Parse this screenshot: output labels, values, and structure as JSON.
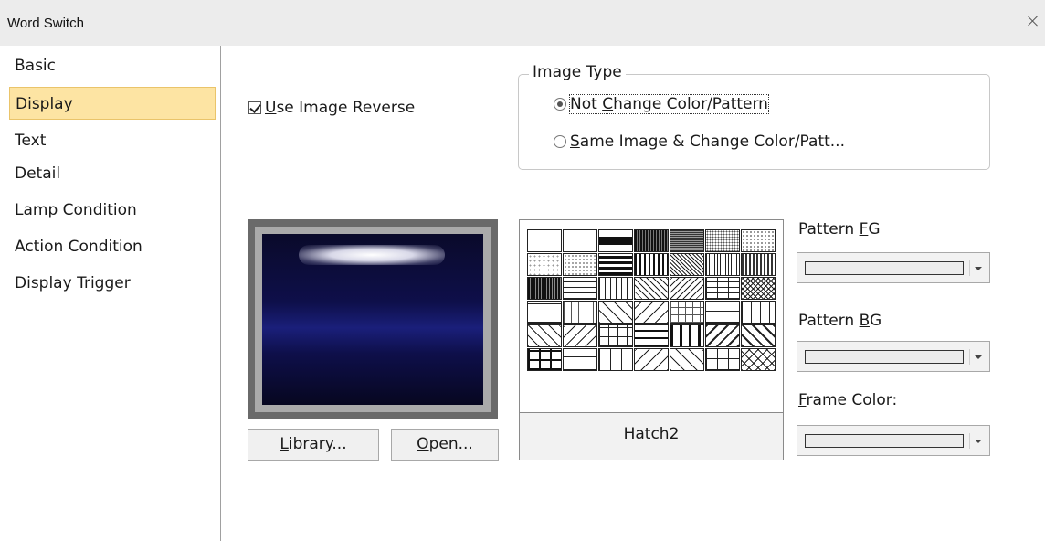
{
  "window": {
    "title": "Word Switch"
  },
  "sidebar": {
    "items": [
      {
        "label": "Basic"
      },
      {
        "label": "Display"
      },
      {
        "label": "Text"
      },
      {
        "label": "Detail"
      },
      {
        "label": "Lamp Condition"
      },
      {
        "label": "Action Condition"
      },
      {
        "label": "Display Trigger"
      }
    ],
    "selected": "Display"
  },
  "display": {
    "use_image_reverse": {
      "label_u": "U",
      "label_rest": "se Image Reverse",
      "checked": true
    },
    "image_type": {
      "legend": "Image Type",
      "options": [
        {
          "pre": "Not ",
          "u": "C",
          "rest": "hange Color/Pattern",
          "selected": true
        },
        {
          "pre": "",
          "u": "S",
          "rest": "ame Image & Change Color/Patt...",
          "selected": false
        }
      ]
    },
    "library_button": {
      "u": "L",
      "rest": "ibrary..."
    },
    "open_button": {
      "u": "O",
      "rest": "pen..."
    },
    "pattern_name": "Hatch2",
    "pattern_fg": {
      "pre": "Pattern ",
      "u": "F",
      "rest": "G"
    },
    "pattern_bg": {
      "pre": "Pattern ",
      "u": "B",
      "rest": "G"
    },
    "frame_color": {
      "pre": "",
      "u": "F",
      "rest": "rame Color:"
    }
  },
  "colors": {
    "selected_bg": "#fde4a3",
    "titlebar_bg": "#ececec"
  }
}
